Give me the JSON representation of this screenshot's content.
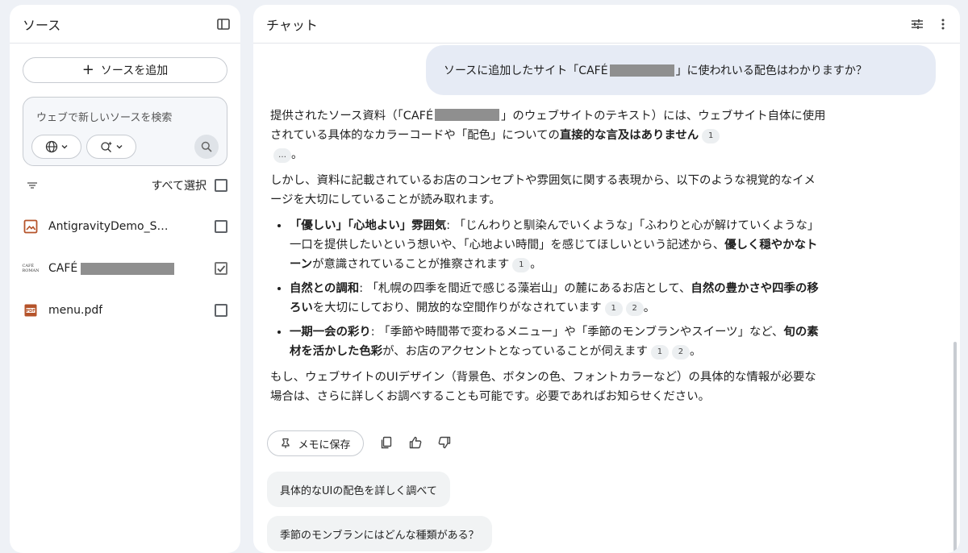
{
  "sources_panel": {
    "title": "ソース",
    "add_button": "ソースを追加",
    "search_placeholder": "ウェブで新しいソースを検索",
    "select_all": "すべて選択",
    "items": [
      {
        "name": "AntigravityDemo_Scr...",
        "icon": "image-icon",
        "checked": false
      },
      {
        "name": "CAFÉ",
        "icon": "cafe-logo-icon",
        "checked": true,
        "redacted": true
      },
      {
        "name": "menu.pdf",
        "icon": "pdf-icon",
        "checked": false
      }
    ]
  },
  "chat_panel": {
    "title": "チャット",
    "user_message": {
      "before": "ソースに追加したサイト「CAFÉ",
      "after": "」に使われいる配色はわかりますか？"
    },
    "answer": {
      "p1_a": "提供されたソース資料（「CAFÉ",
      "p1_b": "」のウェブサイトのテキスト）には、ウェブサイト自体に使用されている具体的なカラーコードや「配色」についての",
      "p1_bold": "直接的な言及はありません",
      "p1_cite": "1",
      "p1_more": "…",
      "p1_end": "。",
      "p2": "しかし、資料に記載されているお店のコンセプトや雰囲気に関する表現から、以下のような視覚的なイメージを大切にしていることが読み取れます。",
      "b1_bold": "「優しい」「心地よい」雰囲気",
      "b1_text": ": 「じんわりと馴染んでいくような」「ふわりと心が解けていくような」一口を提供したいという想いや、「心地よい時間」を感じてほしいという記述から、",
      "b1_bold2": "優しく穏やかなトーン",
      "b1_text2": "が意識されていることが推察されます",
      "b1_cite": "1",
      "b1_end": "。",
      "b2_bold": "自然との調和",
      "b2_text": ": 「札幌の四季を間近で感じる藻岩山」の麓にあるお店として、",
      "b2_bold2": "自然の豊かさや四季の移ろい",
      "b2_text2": "を大切にしており、開放的な空間作りがなされています",
      "b2_cite1": "1",
      "b2_cite2": "2",
      "b2_end": "。",
      "b3_bold": "一期一会の彩り",
      "b3_text": ": 「季節や時間帯で変わるメニュー」や「季節のモンブランやスイーツ」など、",
      "b3_bold2": "旬の素材を活かした色彩",
      "b3_text2": "が、お店のアクセントとなっていることが伺えます",
      "b3_cite1": "1",
      "b3_cite2": "2",
      "b3_end": "。",
      "p3": "もし、ウェブサイトのUIデザイン（背景色、ボタンの色、フォントカラーなど）の具体的な情報が必要な場合は、さらに詳しくお調べすることも可能です。必要であればお知らせください。"
    },
    "memo_button": "メモに保存",
    "suggestions": [
      "具体的なUIの配色を詳しく調べて",
      "季節のモンブランにはどんな種類がある？"
    ]
  }
}
